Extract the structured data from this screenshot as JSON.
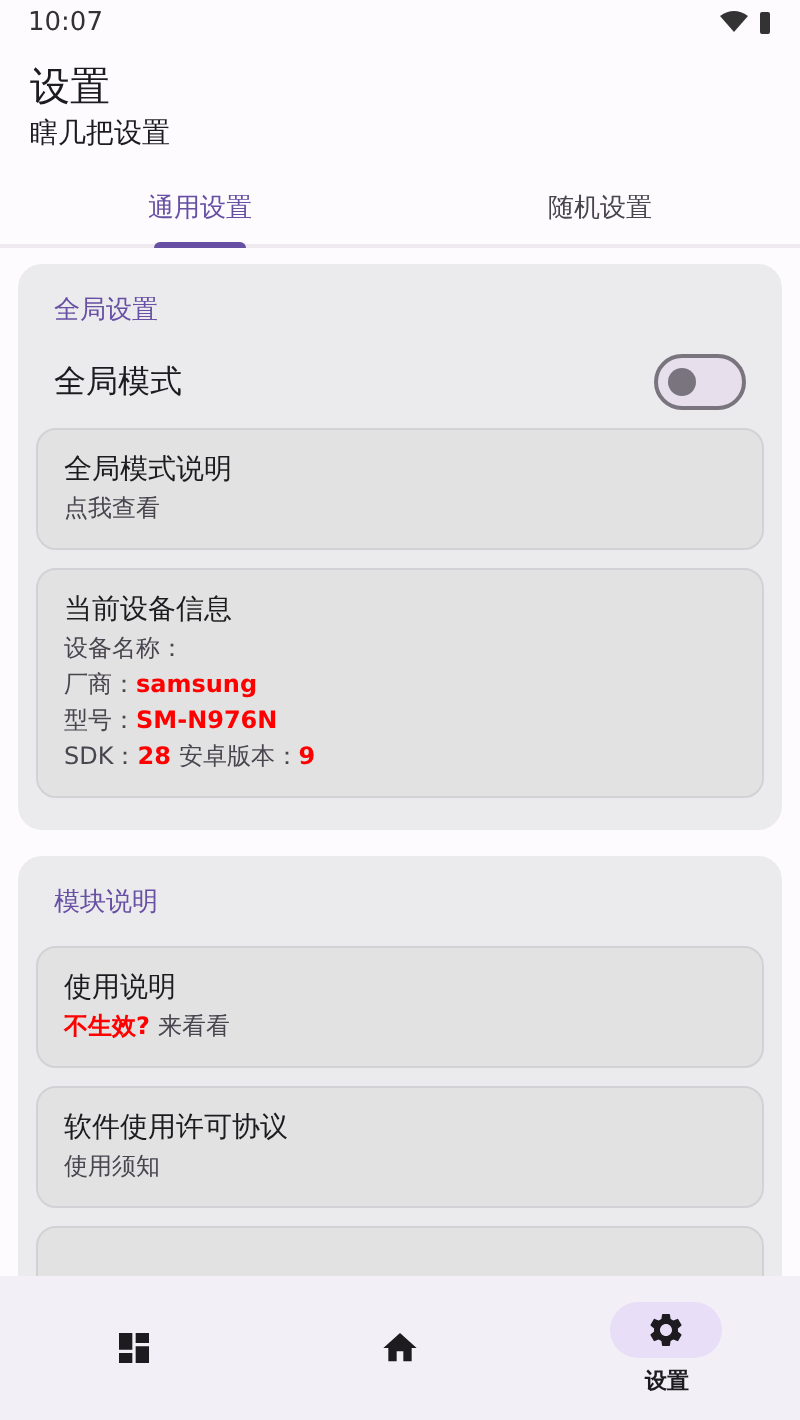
{
  "status_bar": {
    "time": "10:07"
  },
  "header": {
    "title": "设置",
    "subtitle": "瞎几把设置"
  },
  "tabs": [
    {
      "label": "通用设置",
      "selected": true
    },
    {
      "label": "随机设置",
      "selected": false
    }
  ],
  "sections": [
    {
      "title": "全局设置",
      "switch": {
        "label": "全局模式",
        "on": false
      },
      "items": [
        {
          "title": "全局模式说明",
          "lines": [
            "点我查看"
          ]
        },
        {
          "title": "当前设备信息",
          "lines": [
            "设备名称：",
            "厂商：**samsung**",
            "型号：**SM-N976N**",
            "SDK：**28** 安卓版本：**9**"
          ]
        }
      ]
    },
    {
      "title": "模块说明",
      "items": [
        {
          "title": "使用说明",
          "lines": [
            "**不生效?** 来看看"
          ]
        },
        {
          "title": "软件使用许可协议",
          "lines": [
            "使用须知"
          ]
        },
        {
          "kind": "cut"
        }
      ]
    }
  ],
  "bottom_nav": [
    {
      "kind": "dashboard",
      "selected": false
    },
    {
      "kind": "home",
      "selected": false
    },
    {
      "kind": "settings",
      "selected": true,
      "label": "设置"
    }
  ]
}
